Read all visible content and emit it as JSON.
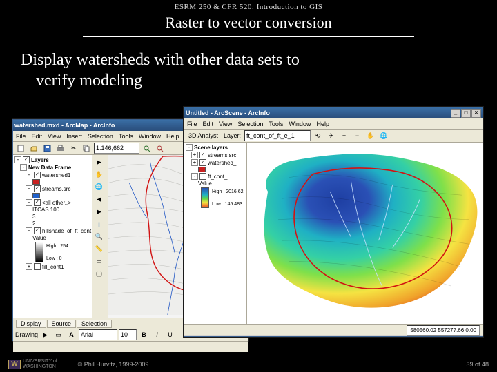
{
  "slide": {
    "course": "ESRM 250 & CFR 520: Introduction to GIS",
    "title": "Raster to vector conversion",
    "body_line1": "Display watersheds with other data sets to",
    "body_line2": "verify modeling"
  },
  "arcmap": {
    "title": "watershed.mxd - ArcMap - ArcInfo",
    "window_controls": {
      "min": "_",
      "max": "□",
      "close": "×"
    },
    "menu": [
      "File",
      "Edit",
      "View",
      "Insert",
      "Selection",
      "Tools",
      "Window",
      "Help"
    ],
    "scale": "1:146,662",
    "toc": {
      "layers_label": "Layers",
      "frame_label": "New Data Frame",
      "nodes": [
        {
          "label": "watershed1",
          "checked": true
        },
        {
          "label": "streams.src",
          "checked": true
        },
        {
          "label": "<all other..>",
          "checked": true
        },
        {
          "label": "ITCAS 100",
          "indent": 2
        },
        {
          "label": "3",
          "indent": 2
        },
        {
          "label": "2",
          "indent": 2
        },
        {
          "label": "hillshade_of_ft_cont",
          "checked": true
        },
        {
          "label": "Value",
          "indent": 2
        },
        {
          "label": "High : 254",
          "indent": 3
        },
        {
          "label": "Low : 0",
          "indent": 3
        },
        {
          "label": "fill_cont1",
          "checked": false
        }
      ]
    },
    "tabs": [
      "Display",
      "Source",
      "Selection"
    ],
    "drawing_label": "Drawing",
    "font_name": "Arial",
    "font_size": "10"
  },
  "arcscene": {
    "title": "Untitled - ArcScene - ArcInfo",
    "window_controls": {
      "min": "_",
      "max": "□",
      "close": "×"
    },
    "menu": [
      "File",
      "Edit",
      "View",
      "Selection",
      "Tools",
      "Window",
      "Help"
    ],
    "analyst_label": "3D Analyst",
    "layer_label": "Layer:",
    "layer_value": "ft_cont_of_ft_e_1",
    "toc": {
      "scene_label": "Scene layers",
      "nodes": [
        {
          "label": "streams.src",
          "checked": true
        },
        {
          "label": "watershed_",
          "checked": true
        },
        {
          "label": "ft_cont_",
          "checked": false
        },
        {
          "label": "Value",
          "indent": 2
        },
        {
          "label": "High : 2016.62",
          "indent": 3
        },
        {
          "label": "Low : 145.483",
          "indent": 3
        }
      ]
    },
    "status": "580560.02   557277.66  0.00"
  },
  "footer": {
    "logo": "W",
    "uni_line1": "UNIVERSITY of",
    "uni_line2": "WASHINGTON",
    "copyright": "© Phil Hurvitz, 1999-2009",
    "page": "39 of 48"
  }
}
